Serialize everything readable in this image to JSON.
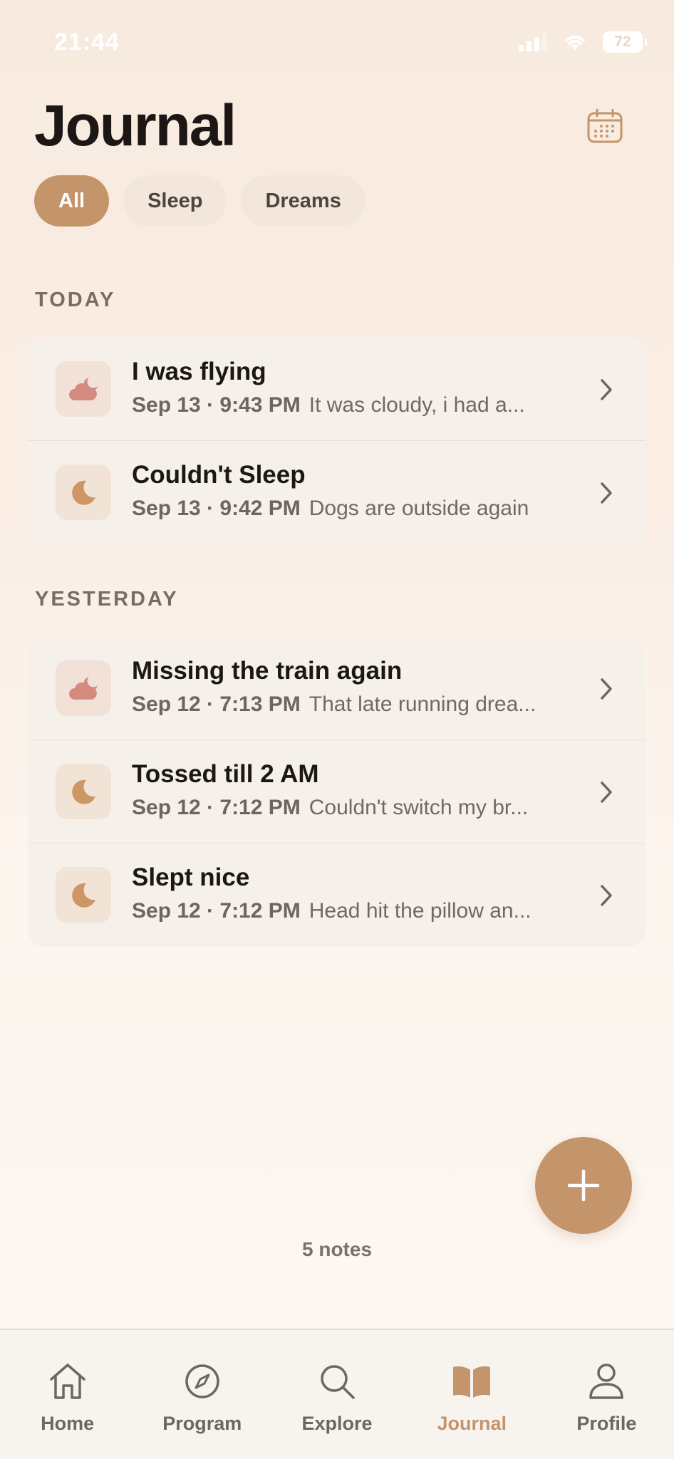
{
  "status_bar": {
    "time": "21:44",
    "battery": "72"
  },
  "header": {
    "title": "Journal"
  },
  "filters": [
    {
      "label": "All",
      "active": true
    },
    {
      "label": "Sleep",
      "active": false
    },
    {
      "label": "Dreams",
      "active": false
    }
  ],
  "sections": [
    {
      "label": "TODAY",
      "entries": [
        {
          "type": "dream",
          "title": "I was flying",
          "date": "Sep 13 · 9:43 PM",
          "preview": "It was cloudy, i had a..."
        },
        {
          "type": "sleep",
          "title": "Couldn't Sleep",
          "date": "Sep 13 · 9:42 PM",
          "preview": "Dogs are outside again"
        }
      ]
    },
    {
      "label": "YESTERDAY",
      "entries": [
        {
          "type": "dream",
          "title": "Missing the train again",
          "date": "Sep 12 · 7:13 PM",
          "preview": "That late running drea..."
        },
        {
          "type": "sleep",
          "title": "Tossed till 2 AM",
          "date": "Sep 12 · 7:12 PM",
          "preview": "Couldn't switch my br..."
        },
        {
          "type": "sleep",
          "title": "Slept nice",
          "date": "Sep 12 · 7:12 PM",
          "preview": "Head hit the pillow an..."
        }
      ]
    }
  ],
  "footer": {
    "notes_count": "5 notes"
  },
  "tab_bar": [
    {
      "label": "Home",
      "icon": "home-icon",
      "active": false
    },
    {
      "label": "Program",
      "icon": "compass-icon",
      "active": false
    },
    {
      "label": "Explore",
      "icon": "search-icon",
      "active": false
    },
    {
      "label": "Journal",
      "icon": "book-icon",
      "active": true
    },
    {
      "label": "Profile",
      "icon": "person-icon",
      "active": false
    }
  ],
  "colors": {
    "accent": "#c4956a",
    "dream_icon": "#d48a7e",
    "sleep_icon": "#cc9765",
    "text_primary": "#1c1714",
    "text_secondary": "#726860"
  }
}
